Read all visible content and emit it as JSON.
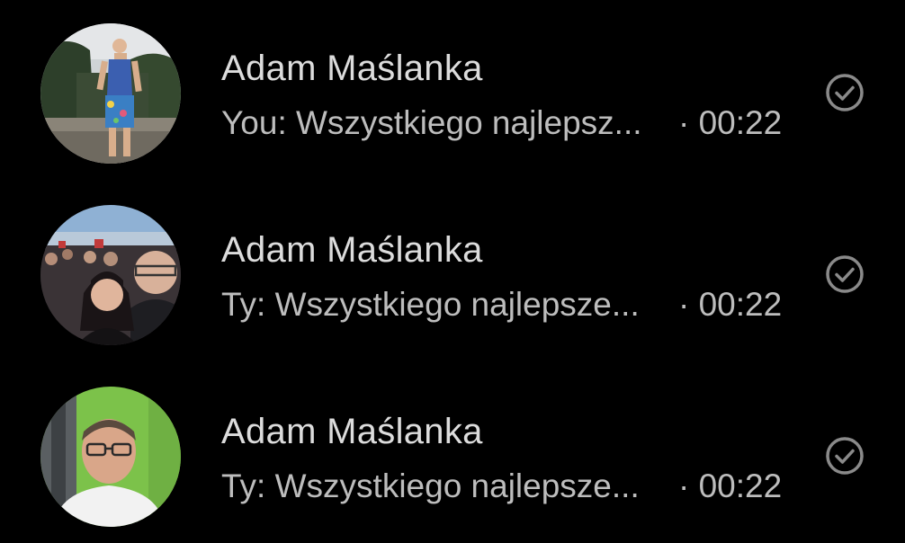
{
  "chats": [
    {
      "name": "Adam Maślanka",
      "snippet": "You: Wszystkiego najlepsz...",
      "time": "· 00:22",
      "status_icon": "sent-check-circle-icon"
    },
    {
      "name": "Adam Maślanka",
      "snippet": "Ty: Wszystkiego najlepsze...",
      "time": "· 00:22",
      "status_icon": "sent-check-circle-icon"
    },
    {
      "name": "Adam Maślanka",
      "snippet": "Ty: Wszystkiego najlepsze...",
      "time": "· 00:22",
      "status_icon": "sent-check-circle-icon"
    }
  ],
  "colors": {
    "background": "#000000",
    "name_text": "#dcdcdc",
    "snippet_text": "#bdbdbd",
    "status_icon": "#8a8a8a"
  }
}
